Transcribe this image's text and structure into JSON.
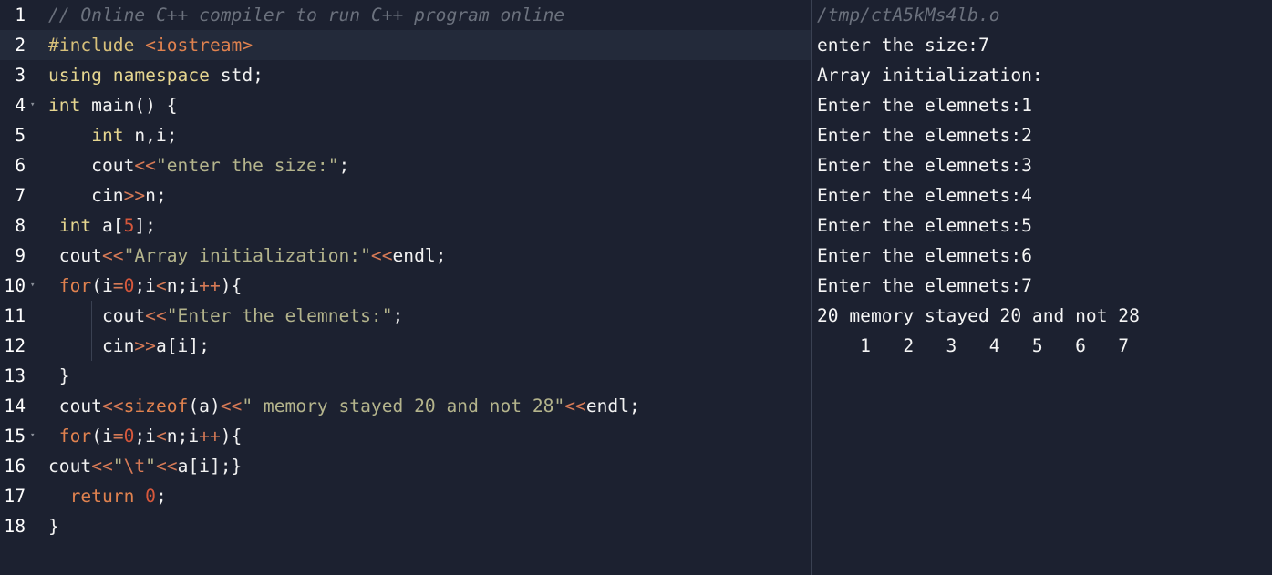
{
  "editor": {
    "line_numbers": [
      "1",
      "2",
      "3",
      "4",
      "5",
      "6",
      "7",
      "8",
      "9",
      "10",
      "11",
      "12",
      "13",
      "14",
      "15",
      "16",
      "17",
      "18"
    ],
    "fold_marker": "▾",
    "lines": [
      [
        {
          "t": "// Online C++ compiler to run C++ program online",
          "c": "cm"
        }
      ],
      [
        {
          "t": "#include ",
          "c": "pre"
        },
        {
          "t": "<iostream>",
          "c": "inc"
        }
      ],
      [
        {
          "t": "using namespace ",
          "c": "kw"
        },
        {
          "t": "std;",
          "c": ""
        }
      ],
      [
        {
          "t": "int",
          "c": "kw"
        },
        {
          "t": " main() {",
          "c": ""
        }
      ],
      [
        {
          "t": "    ",
          "c": ""
        },
        {
          "t": "int",
          "c": "kw"
        },
        {
          "t": " n,i;",
          "c": ""
        }
      ],
      [
        {
          "t": "    cout",
          "c": ""
        },
        {
          "t": "<<",
          "c": "op"
        },
        {
          "t": "\"enter the size:\"",
          "c": "str"
        },
        {
          "t": ";",
          "c": ""
        }
      ],
      [
        {
          "t": "    cin",
          "c": ""
        },
        {
          "t": ">>",
          "c": "op"
        },
        {
          "t": "n;",
          "c": ""
        }
      ],
      [
        {
          "t": " ",
          "c": ""
        },
        {
          "t": "int",
          "c": "kw"
        },
        {
          "t": " a[",
          "c": ""
        },
        {
          "t": "5",
          "c": "num"
        },
        {
          "t": "];",
          "c": ""
        }
      ],
      [
        {
          "t": " cout",
          "c": ""
        },
        {
          "t": "<<",
          "c": "op"
        },
        {
          "t": "\"Array initialization:\"",
          "c": "str"
        },
        {
          "t": "<<",
          "c": "op"
        },
        {
          "t": "endl;",
          "c": ""
        }
      ],
      [
        {
          "t": " ",
          "c": ""
        },
        {
          "t": "for",
          "c": "fn"
        },
        {
          "t": "(i",
          "c": ""
        },
        {
          "t": "=",
          "c": "op"
        },
        {
          "t": "0",
          "c": "num"
        },
        {
          "t": ";i",
          "c": ""
        },
        {
          "t": "<",
          "c": "op"
        },
        {
          "t": "n;i",
          "c": ""
        },
        {
          "t": "++",
          "c": "op"
        },
        {
          "t": "){",
          "c": ""
        }
      ],
      [
        {
          "t": "     cout",
          "c": ""
        },
        {
          "t": "<<",
          "c": "op"
        },
        {
          "t": "\"Enter the elemnets:\"",
          "c": "str"
        },
        {
          "t": ";",
          "c": ""
        }
      ],
      [
        {
          "t": "     cin",
          "c": ""
        },
        {
          "t": ">>",
          "c": "op"
        },
        {
          "t": "a[i];",
          "c": ""
        }
      ],
      [
        {
          "t": " }",
          "c": ""
        }
      ],
      [
        {
          "t": " cout",
          "c": ""
        },
        {
          "t": "<<",
          "c": "op"
        },
        {
          "t": "sizeof",
          "c": "fn"
        },
        {
          "t": "(a)",
          "c": ""
        },
        {
          "t": "<<",
          "c": "op"
        },
        {
          "t": "\" memory stayed 20 and not 28\"",
          "c": "str"
        },
        {
          "t": "<<",
          "c": "op"
        },
        {
          "t": "endl;",
          "c": ""
        }
      ],
      [
        {
          "t": " ",
          "c": ""
        },
        {
          "t": "for",
          "c": "fn"
        },
        {
          "t": "(i",
          "c": ""
        },
        {
          "t": "=",
          "c": "op"
        },
        {
          "t": "0",
          "c": "num"
        },
        {
          "t": ";i",
          "c": ""
        },
        {
          "t": "<",
          "c": "op"
        },
        {
          "t": "n;i",
          "c": ""
        },
        {
          "t": "++",
          "c": "op"
        },
        {
          "t": "){",
          "c": ""
        }
      ],
      [
        {
          "t": "cout",
          "c": ""
        },
        {
          "t": "<<",
          "c": "op"
        },
        {
          "t": "\"",
          "c": "str"
        },
        {
          "t": "\\t",
          "c": "esc"
        },
        {
          "t": "\"",
          "c": "str"
        },
        {
          "t": "<<",
          "c": "op"
        },
        {
          "t": "a[i];}",
          "c": ""
        }
      ],
      [
        {
          "t": "  ",
          "c": ""
        },
        {
          "t": "return",
          "c": "fn"
        },
        {
          "t": " ",
          "c": ""
        },
        {
          "t": "0",
          "c": "num"
        },
        {
          "t": ";",
          "c": ""
        }
      ],
      [
        {
          "t": "}",
          "c": ""
        }
      ]
    ],
    "folded_lines": [
      3,
      9,
      14
    ],
    "active_line": 1,
    "guide_lines": [
      10,
      11
    ]
  },
  "output": {
    "path": "/tmp/ctA5kMs4lb.o",
    "lines": [
      "enter the size:7",
      "Array initialization:",
      "Enter the elemnets:1",
      "Enter the elemnets:2",
      "Enter the elemnets:3",
      "Enter the elemnets:4",
      "Enter the elemnets:5",
      "Enter the elemnets:6",
      "Enter the elemnets:7",
      "20 memory stayed 20 and not 28",
      "    1   2   3   4   5   6   7"
    ]
  }
}
